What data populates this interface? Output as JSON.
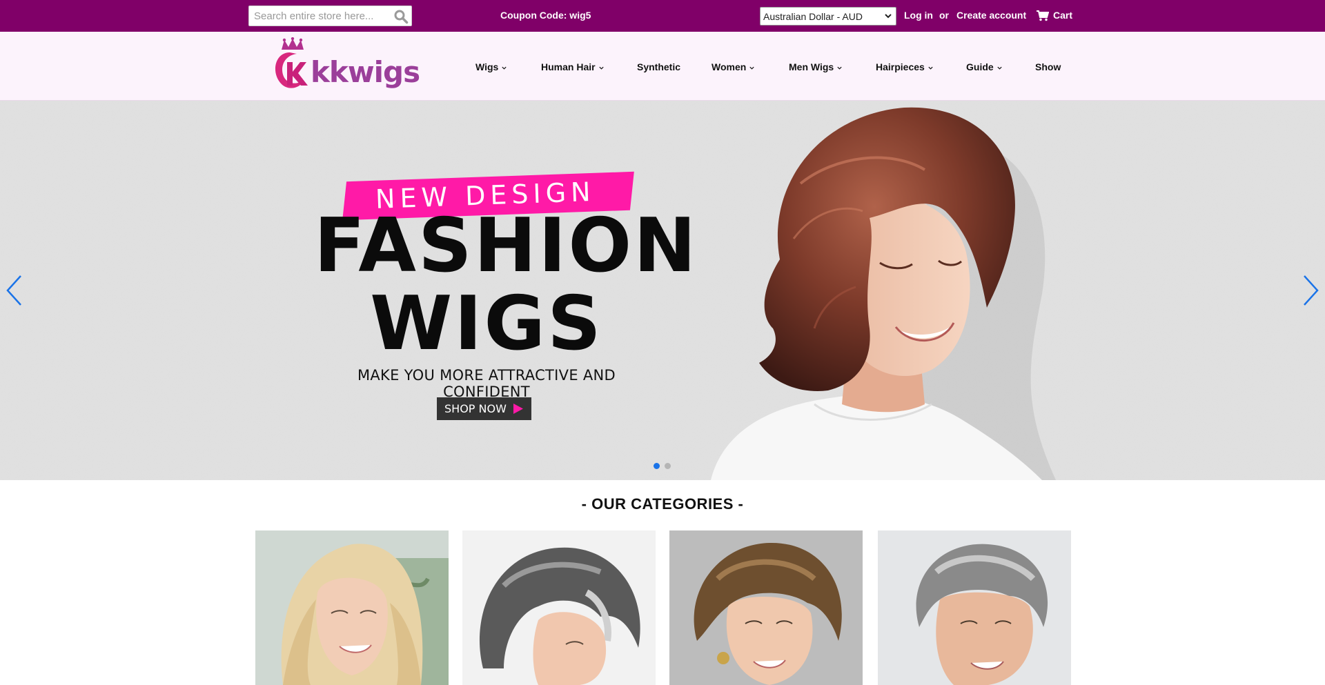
{
  "topbar": {
    "search_placeholder": "Search entire store here...",
    "coupon": "Coupon Code: wig5",
    "currency_selected": "Australian Dollar - AUD",
    "login": "Log in",
    "or": "or",
    "create_account": "Create account",
    "cart": "Cart",
    "background_color": "#800068"
  },
  "header": {
    "logo_text": "kkwigs",
    "nav": [
      "Wigs",
      "Human Hair",
      "Synthetic",
      "Women",
      "Men Wigs",
      "Hairpieces",
      "Guide",
      "Show"
    ],
    "nav_has_dropdown": [
      true,
      true,
      false,
      true,
      true,
      true,
      true,
      false
    ],
    "background_color": "#fcf3fc"
  },
  "hero": {
    "ribbon_text": "NEW DESIGN",
    "headline_line1": "FASHION",
    "headline_line2": "WIGS",
    "tagline": "MAKE YOU MORE ATTRACTIVE AND CONFIDENT",
    "cta": "SHOP NOW",
    "ribbon_color": "#ff1aa7",
    "active_slide": 1,
    "slide_count": 2
  },
  "categories": {
    "title": "- OUR CATEGORIES -",
    "cards": [
      "blonde-long-wig",
      "grey-curly-short-wig",
      "brown-curly-short-wig",
      "men-grey-wig"
    ]
  },
  "accent_color": "#1a73e8"
}
